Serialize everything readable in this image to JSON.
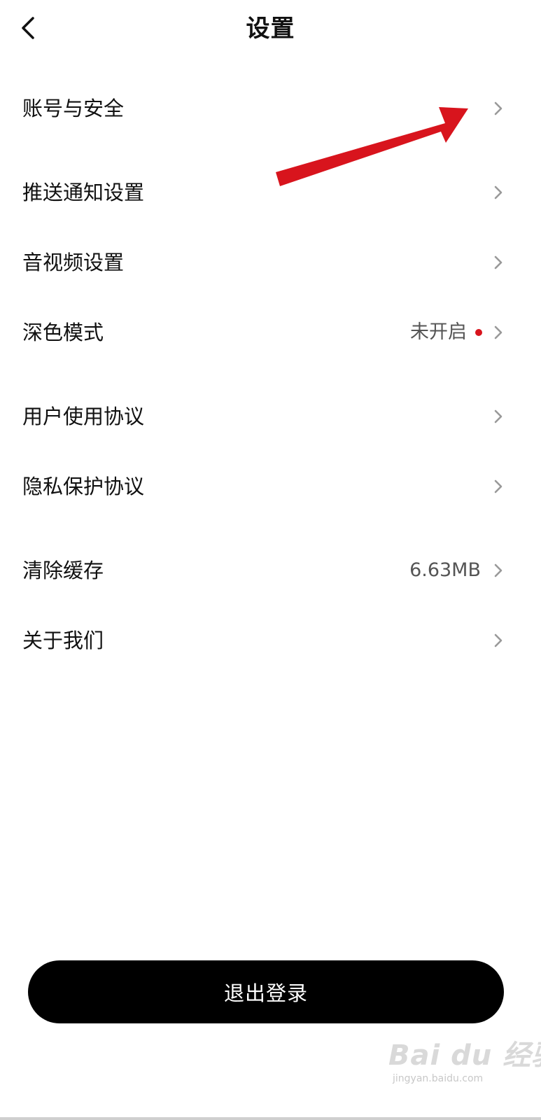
{
  "header": {
    "title": "设置",
    "back_icon": "chevron-left-icon"
  },
  "settings": {
    "items": [
      {
        "label": "账号与安全",
        "value": "",
        "has_dot": false
      },
      {
        "label": "推送通知设置",
        "value": "",
        "has_dot": false
      },
      {
        "label": "音视频设置",
        "value": "",
        "has_dot": false
      },
      {
        "label": "深色模式",
        "value": "未开启",
        "has_dot": true
      },
      {
        "label": "用户使用协议",
        "value": "",
        "has_dot": false
      },
      {
        "label": "隐私保护协议",
        "value": "",
        "has_dot": false
      },
      {
        "label": "清除缓存",
        "value": "6.63MB",
        "has_dot": false
      },
      {
        "label": "关于我们",
        "value": "",
        "has_dot": false
      }
    ]
  },
  "logout": {
    "label": "退出登录"
  },
  "watermark": {
    "brand": "Bai du 经验",
    "url": "jingyan.baidu.com"
  },
  "colors": {
    "background": "#ffffff",
    "text": "#111111",
    "value_text": "#555555",
    "chevron": "#999999",
    "dot": "#d8141d",
    "annotation_arrow": "#d8141d",
    "logout_bg": "#000000",
    "logout_text": "#ffffff"
  }
}
